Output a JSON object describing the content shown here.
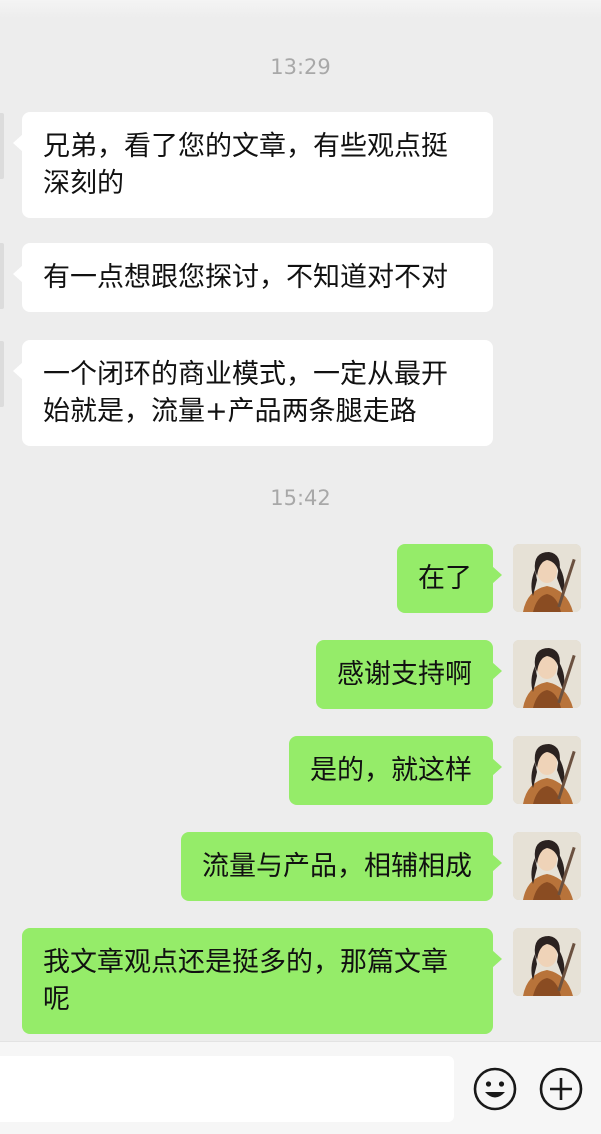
{
  "timestamps": [
    "13:29",
    "15:42"
  ],
  "incoming": [
    {
      "text": "兄弟，看了您的文章，有些观点挺深刻的"
    },
    {
      "text": "有一点想跟您探讨，不知道对不对"
    },
    {
      "text": "一个闭环的商业模式，一定从最开始就是，流量+产品两条腿走路"
    }
  ],
  "outgoing": [
    {
      "text": "在了"
    },
    {
      "text": "感谢支持啊"
    },
    {
      "text": "是的，就这样"
    },
    {
      "text": "流量与产品，相辅相成"
    },
    {
      "text": "我文章观点还是挺多的，那篇文章呢"
    }
  ],
  "input_bar": {
    "value": "",
    "icons": [
      "emoji-icon",
      "plus-icon"
    ]
  },
  "colors": {
    "background": "#ededed",
    "incoming_bubble": "#ffffff",
    "outgoing_bubble": "#95ec69",
    "timestamp": "#a8a8a8"
  }
}
